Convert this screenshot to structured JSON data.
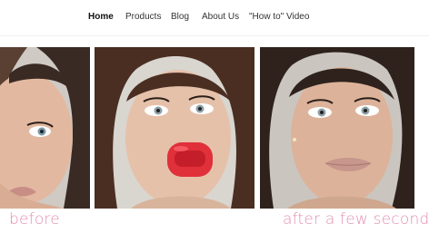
{
  "nav": {
    "items": [
      {
        "label": "Home",
        "active": true
      },
      {
        "label": "Products",
        "active": false
      },
      {
        "label": "Blog",
        "active": false
      },
      {
        "label": "About Us",
        "active": false
      },
      {
        "label": "\"How to\" Video",
        "active": false
      }
    ]
  },
  "gallery": {
    "photos": [
      {
        "alt": "before"
      },
      {
        "alt": "using lip plumper"
      },
      {
        "alt": "after a few seconds"
      }
    ],
    "captions": {
      "before": "before",
      "after": "after a few seconds"
    }
  },
  "colors": {
    "caption": "#e28fb0",
    "lip_device": "#e0303a"
  }
}
